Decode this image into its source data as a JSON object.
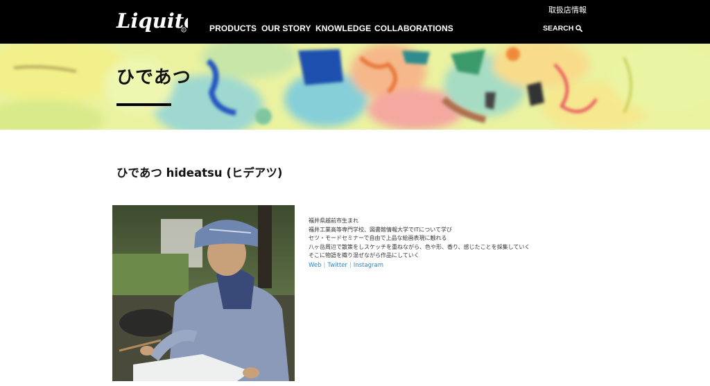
{
  "header": {
    "logo_text": "Liquitex",
    "dealer_link": "取扱店情報",
    "nav": [
      "PRODUCTS",
      "OUR STORY",
      "KNOWLEDGE",
      "COLLABORATIONS"
    ],
    "search_label": "SEARCH",
    "search_icon": "search-icon"
  },
  "hero": {
    "title": "ひであつ"
  },
  "artist": {
    "name": "ひであつ hideatsu (ヒデアツ)",
    "bio": [
      "福井県越前市生まれ",
      "福井工業高等専門学校、図書館情報大学でITについて学び",
      "セツ・モードセミナーで自由で上品な絵画表現に触れる",
      "八ヶ岳周辺で散策をしスケッチを重ねながら、色や形、香り、感じたことを採集していく",
      "そこに物語を織り混ぜながら作品にしていく"
    ],
    "links": [
      "Web",
      "Twitter",
      "Instagram"
    ],
    "link_separator": "|"
  },
  "colors": {
    "header_bg": "#000000",
    "link": "#2a85d8",
    "text": "#111111"
  }
}
